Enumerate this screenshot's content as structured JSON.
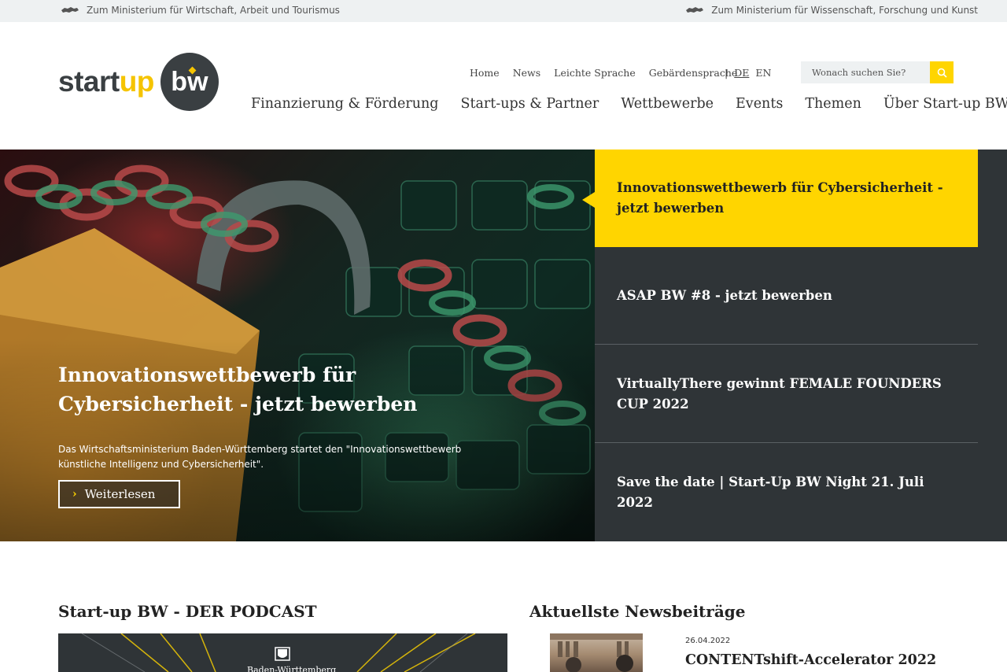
{
  "topbar": {
    "left_link": "Zum Ministerium für Wirtschaft, Arbeit und Tourismus",
    "right_link": "Zum Ministerium für Wissenschaft, Forschung und Kunst"
  },
  "logo": {
    "part1": "start",
    "part2": "up",
    "badge": "bw"
  },
  "utility_nav": [
    "Home",
    "News",
    "Leichte Sprache",
    "Gebärdensprache"
  ],
  "language": {
    "separator": "|",
    "active": "DE",
    "other": "EN"
  },
  "search": {
    "placeholder": "Wonach suchen Sie?",
    "icon": "search-icon"
  },
  "main_nav": [
    "Finanzierung & Förderung",
    "Start-ups & Partner",
    "Wettbewerbe",
    "Events",
    "Themen",
    "Über Start-up BW"
  ],
  "hero": {
    "title": "Innovationswettbewerb für Cybersicherheit - jetzt bewerben",
    "text": "Das Wirtschaftsministerium Baden-Württemberg startet den \"Innovationswettbewerb künstliche Intelligenz und Cybersicherheit\".",
    "button_label": "Weiterlesen"
  },
  "slides": [
    "Innovationswettbewerb für Cybersicherheit - jetzt bewerben",
    "ASAP BW #8 - jetzt bewerben",
    "VirtuallyThere gewinnt FEMALE FOUNDERS CUP 2022",
    "Save the date | Start-Up BW Night 21. Juli 2022"
  ],
  "colors": {
    "accent": "#ffd500",
    "dark": "#2f3437"
  },
  "podcast": {
    "title": "Start-up BW - DER PODCAST",
    "banner_label": "Baden-Württemberg"
  },
  "news": {
    "title": "Aktuellste Newsbeiträge",
    "items": [
      {
        "date": "26.04.2022",
        "title": "CONTENTshift-Accelerator 2022"
      }
    ]
  }
}
